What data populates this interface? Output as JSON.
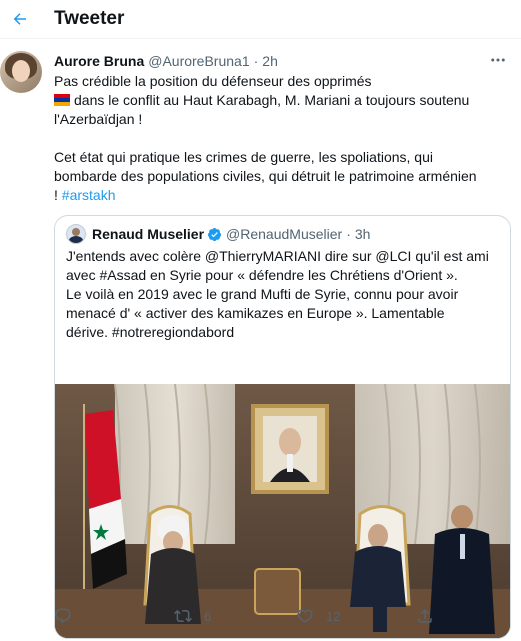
{
  "header": {
    "title": "Tweeter",
    "back_icon": "arrow-left-icon"
  },
  "tweet": {
    "author_name": "Aurore Bruna",
    "author_handle": "@AuroreBruna1",
    "separator": "·",
    "time": "2h",
    "more_icon": "ellipsis-icon",
    "text_line1": "Pas crédible la position du défenseur des opprimés",
    "text_line2": "dans le conflit au Haut Karabagh, M. Mariani a toujours soutenu",
    "text_line3": "l'Azerbaïdjan !",
    "text_line4": "Cet état qui pratique les crimes de guerre, les spoliations, qui",
    "text_line5": "bombarde des populations civiles, qui détruit le patrimoine arménien",
    "text_line6_prefix": "!",
    "hashtag": "#arstakh",
    "flag_icon": "armenia-flag-icon"
  },
  "quote": {
    "author_name": "Renaud Muselier",
    "author_handle": "@RenaudMuselier",
    "separator": "·",
    "time": "3h",
    "verified_icon": "verified-badge-icon",
    "line1": "J'entends avec colère @ThierryMARIANI dire sur @LCI qu'il est ami",
    "line2": "avec #Assad en Syrie pour « défendre les Chrétiens d'Orient ».",
    "line3": "Le voilà en 2019 avec le grand Mufti de Syrie, connu pour avoir",
    "line4": "menacé d' « activer des kamikazes en Europe ». Lamentable",
    "line5": "dérive. #notreregiondabord"
  },
  "actions": {
    "reply_icon": "reply-icon",
    "retweet_icon": "retweet-icon",
    "retweet_count": "6",
    "like_icon": "heart-icon",
    "like_count": "12",
    "share_icon": "share-icon"
  },
  "colors": {
    "accent": "#1d9bf0",
    "text": "#0f1419",
    "muted": "#536471",
    "border": "#cfd9de"
  }
}
